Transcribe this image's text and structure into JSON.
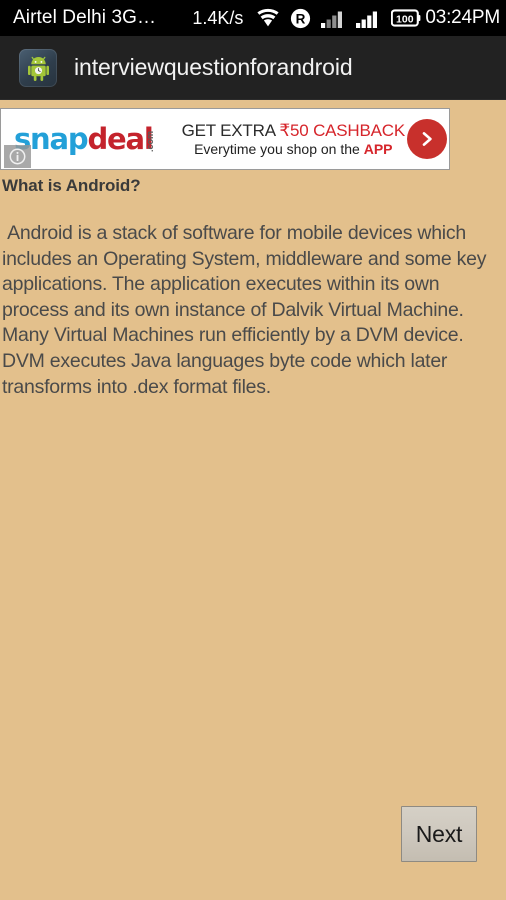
{
  "status_bar": {
    "carrier": "Airtel Delhi 3G…",
    "network_speed": "1.4K/s",
    "wifi_icon": "wifi-icon",
    "roaming_icon": "roaming-icon",
    "roaming_label": "R",
    "signal1_icon": "signal-bars-icon",
    "signal2_icon": "signal-bars-icon",
    "battery_icon": "battery-icon",
    "battery_level": "100",
    "time": "03:24PM",
    "background_color": "#000000",
    "text_color": "#ffffff"
  },
  "action_bar": {
    "app_icon": "android-robot-app-icon",
    "title": "interviewquestionforandroid",
    "background_color": "#222222"
  },
  "ad": {
    "logo_snap": "snap",
    "logo_deal": "deal",
    "logo_com": ".com",
    "headline_dark": "GET  EXTRA ",
    "headline_red": "₹50 CASHBACK",
    "subline_dark": "Everytime you shop on the ",
    "subline_red": "APP",
    "cta_icon": "chevron-right-icon",
    "info_icon": "ad-info-icon",
    "snap_color": "#23a0d8",
    "deal_color": "#c4232c",
    "cta_color": "#c8302c"
  },
  "question": {
    "heading": "What is Android?",
    "body": " Android is a stack of software for mobile devices which includes an Operating System, middleware and some key applications. The application executes within its own process and its own instance of Dalvik Virtual Machine. Many Virtual Machines run efficiently by a DVM device. DVM executes Java languages byte code which later transforms into .dex format files."
  },
  "navigation": {
    "next_label": "Next"
  },
  "theme": {
    "background": "wood-texture",
    "wood_base_color": "#e3c08c",
    "body_text_color": "#4a4a4a",
    "heading_text_color": "#3a3a3a"
  }
}
